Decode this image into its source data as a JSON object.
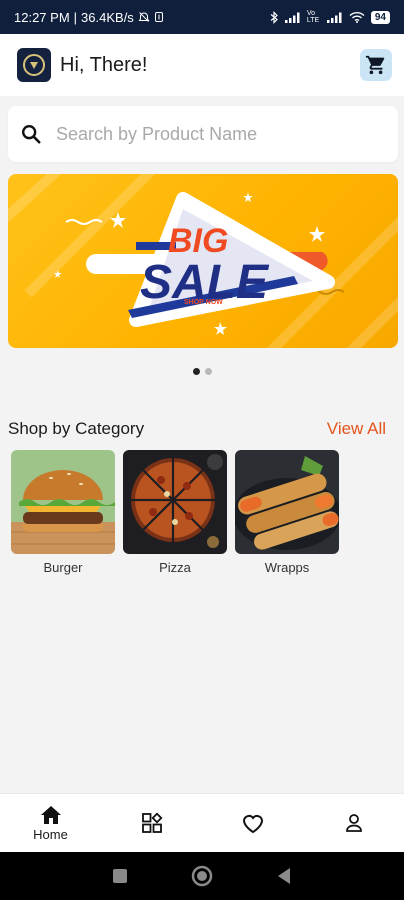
{
  "status_bar": {
    "time": "12:27 PM",
    "speed": "36.4KB/s",
    "network": "Vo LTE",
    "battery": "94"
  },
  "header": {
    "greeting": "Hi, There!"
  },
  "search": {
    "placeholder": "Search by Product Name",
    "value": ""
  },
  "banner": {
    "line1": "BIG",
    "line2": "SALE",
    "cta": "SHOP NOW"
  },
  "carousel": {
    "active_index": 0,
    "count": 2
  },
  "categories_section": {
    "title": "Shop by Category",
    "view_all_label": "View All",
    "items": [
      {
        "label": "Burger"
      },
      {
        "label": "Pizza"
      },
      {
        "label": "Wrapps"
      }
    ]
  },
  "bottom_nav": {
    "items": [
      {
        "label": "Home",
        "icon": "home-icon",
        "active": true
      },
      {
        "label": "",
        "icon": "categories-icon"
      },
      {
        "label": "",
        "icon": "heart-icon"
      },
      {
        "label": "",
        "icon": "profile-icon"
      }
    ]
  },
  "colors": {
    "status_bar": "#0f1f3c",
    "accent": "#e3541e",
    "banner_yellow": "#ffc21a",
    "cart_bg": "#cbe5f7"
  }
}
